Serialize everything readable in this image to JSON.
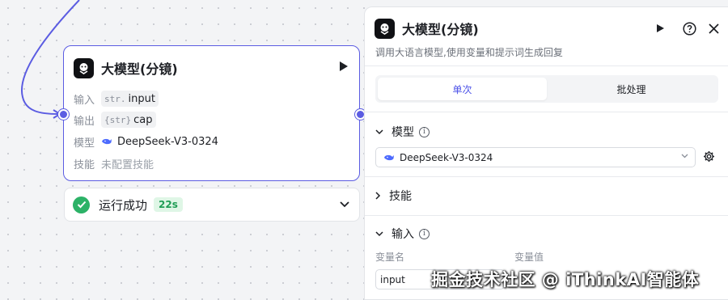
{
  "node": {
    "title": "大模型(分镜)",
    "input_label": "输入",
    "input_type": "str.",
    "input_name": "input",
    "output_label": "输出",
    "output_type": "{str}",
    "output_name": "cap",
    "model_label": "模型",
    "model_name": "DeepSeek-V3-0324",
    "skill_label": "技能",
    "skill_value": "未配置技能"
  },
  "status": {
    "text": "运行成功",
    "duration": "22s"
  },
  "panel": {
    "title": "大模型(分镜)",
    "description": "调用大语言模型,使用变量和提示词生成回复",
    "tabs": [
      {
        "label": "单次",
        "active": true
      },
      {
        "label": "批处理",
        "active": false
      }
    ],
    "model_section": "模型",
    "model_selected": "DeepSeek-V3-0324",
    "skill_section": "技能",
    "input_section": "输入",
    "var_name_col": "变量名",
    "var_value_col": "变量值",
    "var_name_value": "input"
  },
  "watermark": "掘金技术社区 @ iThinkAI智能体",
  "colors": {
    "accent": "#5b5ce2",
    "success": "#2cb267",
    "tab_active": "#4d53e8"
  }
}
